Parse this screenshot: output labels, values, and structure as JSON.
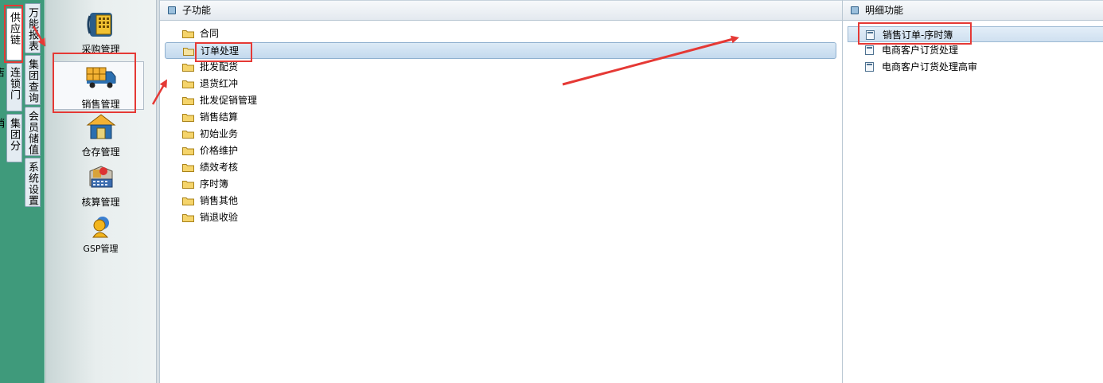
{
  "left_tabs": {
    "col1": [
      "供应链",
      "连锁门店",
      "集团分销"
    ],
    "col2": [
      "万能报表",
      "集团查询",
      "会员储值",
      "系统设置"
    ]
  },
  "modules": [
    {
      "label": "采购管理",
      "icon": "purchase-icon"
    },
    {
      "label": "销售管理",
      "icon": "sales-truck-icon"
    },
    {
      "label": "仓存管理",
      "icon": "warehouse-icon"
    },
    {
      "label": "核算管理",
      "icon": "accounting-icon"
    },
    {
      "label": "GSP管理",
      "icon": "gsp-icon"
    }
  ],
  "sub_panel": {
    "title": "子功能",
    "items": [
      "合同",
      "订单处理",
      "批发配货",
      "退货红冲",
      "批发促销管理",
      "销售结算",
      "初始业务",
      "价格维护",
      "绩效考核",
      "序时簿",
      "销售其他",
      "销退收验"
    ],
    "selected": "订单处理"
  },
  "detail_panel": {
    "title": "明细功能",
    "items": [
      "销售订单-序时簿",
      "电商客户订货处理",
      "电商客户订货处理高审"
    ],
    "selected": "销售订单-序时簿"
  },
  "annotation_color": "#e53935"
}
